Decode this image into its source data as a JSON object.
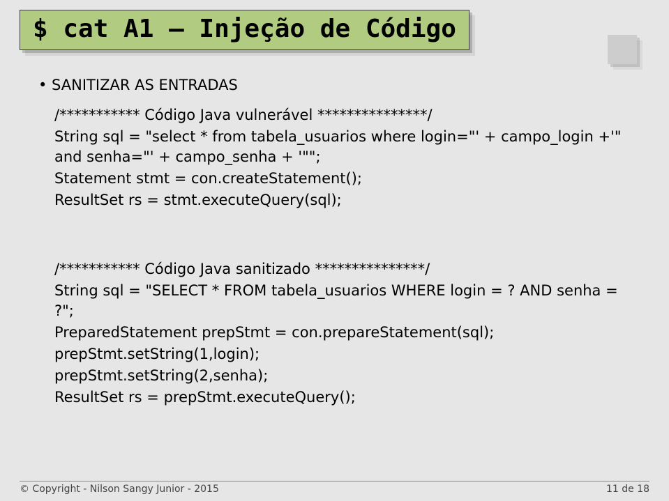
{
  "header": {
    "title": "$ cat A1 – Injeção de Código"
  },
  "bullet": "• SANITIZAR AS ENTRADAS",
  "block1": {
    "l1": "/***********   Código Java vulnerável   ***************/",
    "l2": "String sql = \"select * from tabela_usuarios where login=\"' + campo_login +'\" and senha=\"' + campo_senha + '\"\";",
    "l3": "Statement stmt = con.createStatement();",
    "l4": "ResultSet rs = stmt.executeQuery(sql);"
  },
  "block2": {
    "l1": "/***********   Código Java sanitizado   ***************/",
    "l2": "String sql = \"SELECT * FROM tabela_usuarios WHERE login = ? AND senha = ?\";",
    "l3": "PreparedStatement prepStmt = con.prepareStatement(sql);",
    "l4": "prepStmt.setString(1,login);",
    "l5": "prepStmt.setString(2,senha);",
    "l6": "ResultSet rs = prepStmt.executeQuery();"
  },
  "footer": {
    "left": "© Copyright - Nilson Sangy Junior - 2015",
    "right": "11 de 18"
  }
}
